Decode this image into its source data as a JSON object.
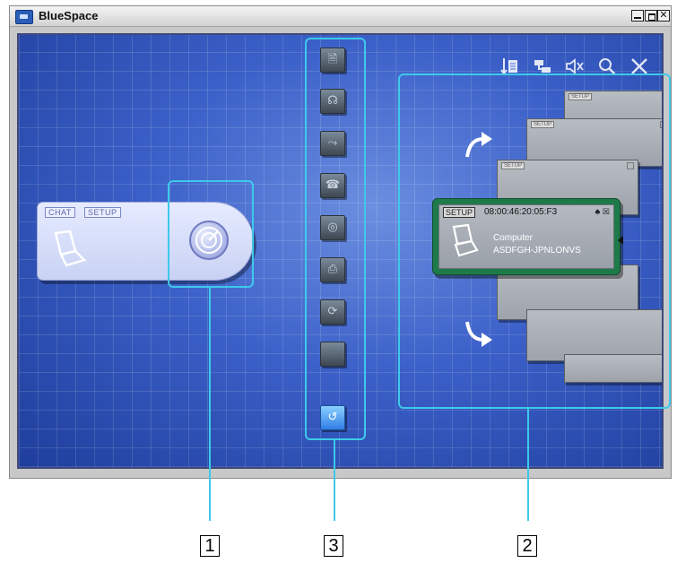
{
  "window": {
    "title": "BlueSpace",
    "controls": [
      "minimize-icon",
      "maximize-icon",
      "close-icon"
    ]
  },
  "toolbar": {
    "icons": [
      "receive-file-icon",
      "network-icon",
      "mute-icon",
      "search-icon",
      "close-icon"
    ]
  },
  "local_device": {
    "tabs": [
      "CHAT",
      "SETUP"
    ],
    "icon": "laptop-icon",
    "action_icon": "radar-search-icon"
  },
  "service_buttons": [
    "file-transfer-icon",
    "headset-icon",
    "network-access-icon",
    "fax-icon",
    "disk-icon",
    "printer-icon",
    "sync-icon",
    "blank-icon",
    "refresh-icon"
  ],
  "selected_remote": {
    "tab": "SETUP",
    "address": "08:00:46:20:05:F3",
    "device_type": "Computer",
    "device_name": "ASDFGH-JPNLONVS"
  },
  "stack_cards": {
    "tab": "SETUP"
  },
  "callouts": [
    "1",
    "3",
    "2"
  ],
  "colors": {
    "accent": "#3ec9ea",
    "background_blue": "#3b60c8",
    "selected_card": "#1f7a4a"
  }
}
